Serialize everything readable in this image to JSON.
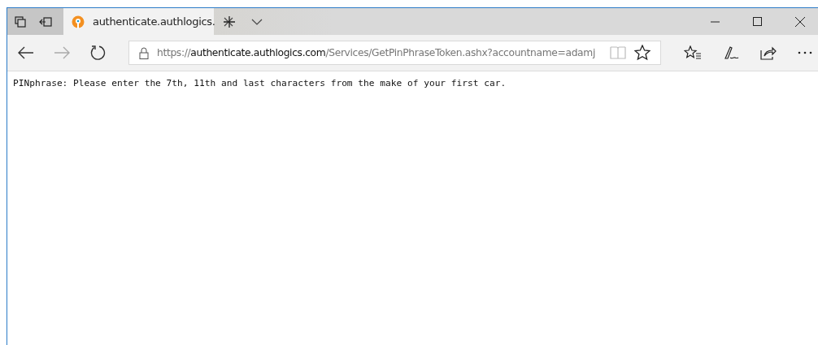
{
  "tabs": [
    {
      "title": "authenticate.authlogics.",
      "selected": true
    }
  ],
  "address_bar": {
    "scheme": "https://",
    "host": "authenticate.authlogics.com",
    "path": "/Services/GetPinPhraseToken.ashx?accountname=adamj"
  },
  "page": {
    "text": "PINphrase: Please enter the 7th, 11th and last characters from the make of your first car."
  }
}
